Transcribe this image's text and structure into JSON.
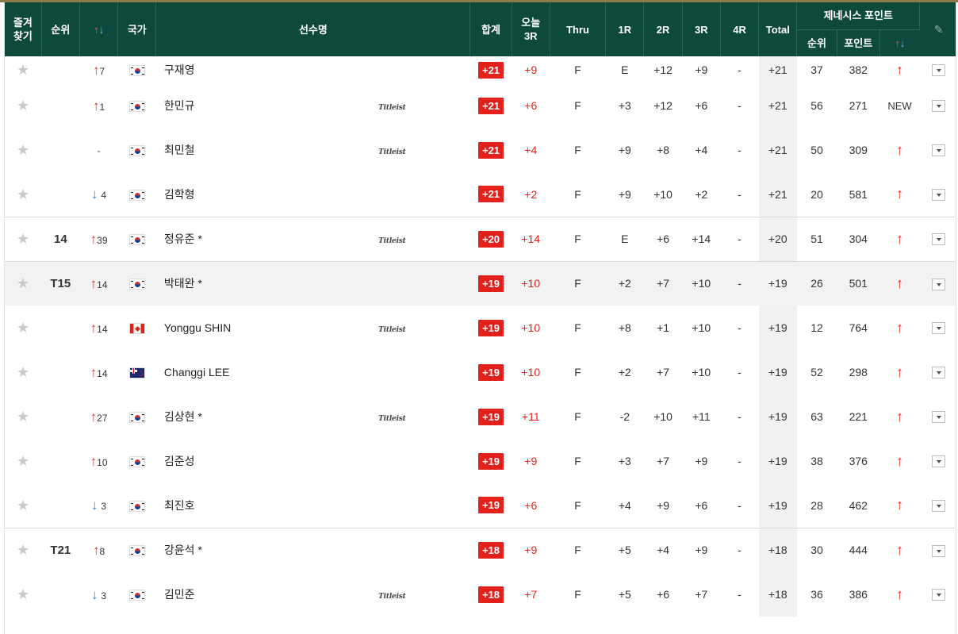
{
  "header": {
    "favorite": "즐겨\n찾기",
    "rank": "순위",
    "move_icon": "up-down-arrows-icon",
    "nation": "국가",
    "player": "선수명",
    "sum": "합계",
    "today": "오늘\n3R",
    "thru": "Thru",
    "r1": "1R",
    "r2": "2R",
    "r3": "3R",
    "r4": "4R",
    "total": "Total",
    "genesis": "제네시스 포인트",
    "g_rank": "순위",
    "g_point": "포인트",
    "edit_icon": "pencil-icon"
  },
  "colors": {
    "header_bg": "#0d4a3b",
    "accent_red": "#e3201b",
    "up": "#e42d1f",
    "down": "#2d84d6"
  },
  "rows": [
    {
      "rank": "",
      "dir": "up",
      "move": "7",
      "flag": "kr",
      "name": "구재영",
      "brand": "",
      "sum": "+21",
      "today": "+9",
      "thru": "F",
      "r1": "E",
      "r2": "+12",
      "r3": "+9",
      "r4": "-",
      "total": "+21",
      "g_rank": "37",
      "g_point": "382",
      "g_change": "up"
    },
    {
      "rank": "",
      "dir": "up",
      "move": "1",
      "flag": "kr",
      "name": "한민규",
      "brand": "Titleist",
      "sum": "+21",
      "today": "+6",
      "thru": "F",
      "r1": "+3",
      "r2": "+12",
      "r3": "+6",
      "r4": "-",
      "total": "+21",
      "g_rank": "56",
      "g_point": "271",
      "g_change": "NEW"
    },
    {
      "rank": "",
      "dir": "none",
      "move": "-",
      "flag": "kr",
      "name": "최민철",
      "brand": "Titleist",
      "sum": "+21",
      "today": "+4",
      "thru": "F",
      "r1": "+9",
      "r2": "+8",
      "r3": "+4",
      "r4": "-",
      "total": "+21",
      "g_rank": "50",
      "g_point": "309",
      "g_change": "up"
    },
    {
      "rank": "",
      "dir": "down",
      "move": "4",
      "flag": "kr",
      "name": "김학형",
      "brand": "",
      "sum": "+21",
      "today": "+2",
      "thru": "F",
      "r1": "+9",
      "r2": "+10",
      "r3": "+2",
      "r4": "-",
      "total": "+21",
      "g_rank": "20",
      "g_point": "581",
      "g_change": "up"
    },
    {
      "rank": "14",
      "dir": "up",
      "move": "39",
      "flag": "kr",
      "name": "정유준 *",
      "brand": "Titleist",
      "sum": "+20",
      "today": "+14",
      "thru": "F",
      "r1": "E",
      "r2": "+6",
      "r3": "+14",
      "r4": "-",
      "total": "+20",
      "g_rank": "51",
      "g_point": "304",
      "g_change": "up"
    },
    {
      "rank": "T15",
      "dir": "up",
      "move": "14",
      "flag": "kr",
      "name": "박태완 *",
      "brand": "",
      "sum": "+19",
      "today": "+10",
      "thru": "F",
      "r1": "+2",
      "r2": "+7",
      "r3": "+10",
      "r4": "-",
      "total": "+19",
      "g_rank": "26",
      "g_point": "501",
      "g_change": "up"
    },
    {
      "rank": "",
      "dir": "up",
      "move": "14",
      "flag": "ca",
      "name": "Yonggu SHIN",
      "brand": "Titleist",
      "sum": "+19",
      "today": "+10",
      "thru": "F",
      "r1": "+8",
      "r2": "+1",
      "r3": "+10",
      "r4": "-",
      "total": "+19",
      "g_rank": "12",
      "g_point": "764",
      "g_change": "up"
    },
    {
      "rank": "",
      "dir": "up",
      "move": "14",
      "flag": "nz",
      "name": "Changgi LEE",
      "brand": "",
      "sum": "+19",
      "today": "+10",
      "thru": "F",
      "r1": "+2",
      "r2": "+7",
      "r3": "+10",
      "r4": "-",
      "total": "+19",
      "g_rank": "52",
      "g_point": "298",
      "g_change": "up"
    },
    {
      "rank": "",
      "dir": "up",
      "move": "27",
      "flag": "kr",
      "name": "김상현 *",
      "brand": "Titleist",
      "sum": "+19",
      "today": "+11",
      "thru": "F",
      "r1": "-2",
      "r2": "+10",
      "r3": "+11",
      "r4": "-",
      "total": "+19",
      "g_rank": "63",
      "g_point": "221",
      "g_change": "up"
    },
    {
      "rank": "",
      "dir": "up",
      "move": "10",
      "flag": "kr",
      "name": "김준성",
      "brand": "",
      "sum": "+19",
      "today": "+9",
      "thru": "F",
      "r1": "+3",
      "r2": "+7",
      "r3": "+9",
      "r4": "-",
      "total": "+19",
      "g_rank": "38",
      "g_point": "376",
      "g_change": "up"
    },
    {
      "rank": "",
      "dir": "down",
      "move": "3",
      "flag": "kr",
      "name": "최진호",
      "brand": "",
      "sum": "+19",
      "today": "+6",
      "thru": "F",
      "r1": "+4",
      "r2": "+9",
      "r3": "+6",
      "r4": "-",
      "total": "+19",
      "g_rank": "28",
      "g_point": "462",
      "g_change": "up"
    },
    {
      "rank": "T21",
      "dir": "up",
      "move": "8",
      "flag": "kr",
      "name": "강윤석 *",
      "brand": "",
      "sum": "+18",
      "today": "+9",
      "thru": "F",
      "r1": "+5",
      "r2": "+4",
      "r3": "+9",
      "r4": "-",
      "total": "+18",
      "g_rank": "30",
      "g_point": "444",
      "g_change": "up"
    },
    {
      "rank": "",
      "dir": "down",
      "move": "3",
      "flag": "kr",
      "name": "김민준",
      "brand": "Titleist",
      "sum": "+18",
      "today": "+7",
      "thru": "F",
      "r1": "+5",
      "r2": "+6",
      "r3": "+7",
      "r4": "-",
      "total": "+18",
      "g_rank": "36",
      "g_point": "386",
      "g_change": "up"
    }
  ]
}
